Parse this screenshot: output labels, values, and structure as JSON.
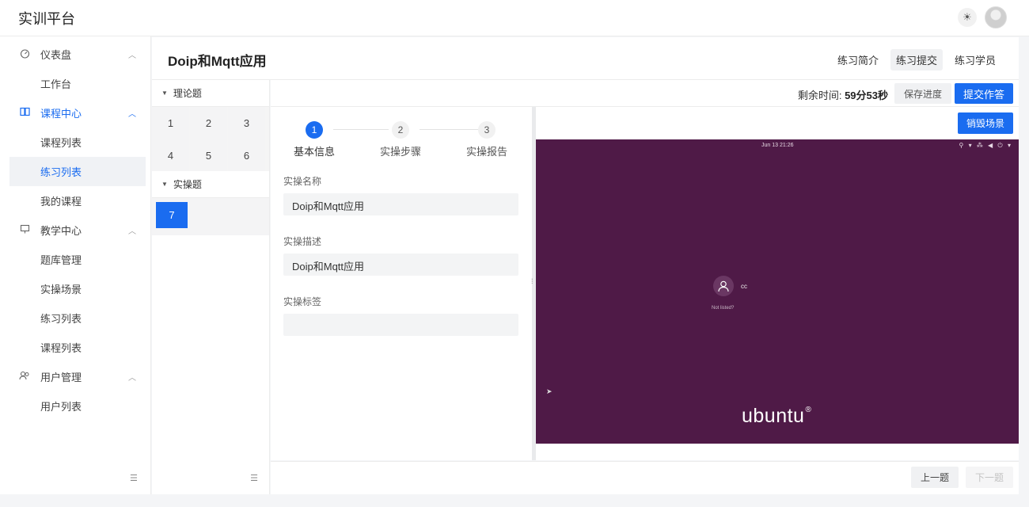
{
  "app": {
    "brand": "实训平台"
  },
  "sidebar": {
    "groups": [
      {
        "label": "仪表盘",
        "icon": "dashboard-icon",
        "items": [
          {
            "label": "工作台"
          }
        ]
      },
      {
        "label": "课程中心",
        "icon": "book-icon",
        "items": [
          {
            "label": "课程列表"
          },
          {
            "label": "练习列表"
          },
          {
            "label": "我的课程"
          }
        ]
      },
      {
        "label": "教学中心",
        "icon": "monitor-icon",
        "items": [
          {
            "label": "题库管理"
          },
          {
            "label": "实操场景"
          },
          {
            "label": "练习列表"
          },
          {
            "label": "课程列表"
          }
        ]
      },
      {
        "label": "用户管理",
        "icon": "users-icon",
        "items": [
          {
            "label": "用户列表"
          }
        ]
      }
    ]
  },
  "header": {
    "title": "Doip和Mqtt应用",
    "tabs": [
      {
        "label": "练习简介"
      },
      {
        "label": "练习提交"
      },
      {
        "label": "练习学员"
      }
    ]
  },
  "questions": {
    "theory_label": "理论题",
    "theory_numbers": [
      "1",
      "2",
      "3",
      "4",
      "5",
      "6"
    ],
    "practice_label": "实操题",
    "practice_numbers": [
      "7"
    ]
  },
  "toolbar": {
    "timer_label": "剩余时间:",
    "timer_value": "59分53秒",
    "save_label": "保存进度",
    "submit_label": "提交作答"
  },
  "steps": [
    {
      "num": "1",
      "label": "基本信息"
    },
    {
      "num": "2",
      "label": "实操步骤"
    },
    {
      "num": "3",
      "label": "实操报告"
    }
  ],
  "form": {
    "name_label": "实操名称",
    "name_value": "Doip和Mqtt应用",
    "desc_label": "实操描述",
    "desc_value": "Doip和Mqtt应用",
    "tag_label": "实操标签",
    "tag_value": ""
  },
  "vm": {
    "destroy_label": "销毁场景",
    "clock": "Jun 13  21:26",
    "username": "cc",
    "login_hint": "Not listed?",
    "logo": "ubuntu",
    "logo_mark": "®",
    "background_color": "#4f1a47"
  },
  "nav_buttons": {
    "prev_label": "上一题",
    "next_label": "下一题"
  },
  "colors": {
    "accent": "#1a6cf0"
  }
}
